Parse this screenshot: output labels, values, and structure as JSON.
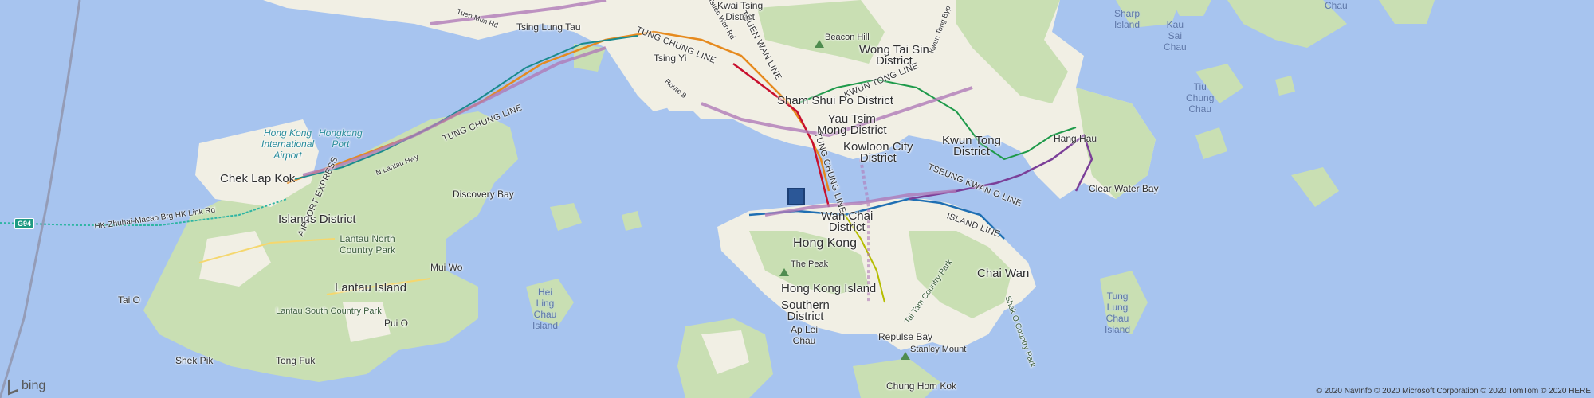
{
  "map": {
    "provider": "bing",
    "copyright": "© 2020 NavInfo © 2020 Microsoft Corporation © 2020 TomTom © 2020 HERE",
    "marker_icon": "location-square-marker",
    "colors": {
      "water": "#a7c4ef",
      "land": "#f1efe4",
      "park": "#c9dfb3",
      "rail_purple": "#b07ab8",
      "rail_red": "#c8102e",
      "rail_orange": "#e68a1e",
      "rail_teal": "#1a8b8e"
    }
  },
  "labels": {
    "kwai_tsing_1": "Kwai Tsing",
    "kwai_tsing_2": "District",
    "beacon_hill": "Beacon Hill",
    "wong_tai_sin_1": "Wong Tai Sin",
    "wong_tai_sin_2": "District",
    "sharp_island_1": "Sharp",
    "sharp_island_2": "Island",
    "kau_sai_chau_1": "Kau",
    "kau_sai_chau_2": "Sai",
    "kau_sai_chau_3": "Chau",
    "chau_top": "Chau",
    "tsing_lung_tau": "Tsing Lung Tau",
    "tsing_yi": "Tsing Yi",
    "sham_shui_po": "Sham Shui Po District",
    "tiu_chung_chau_1": "Tiu",
    "tiu_chung_chau_2": "Chung",
    "tiu_chung_chau_3": "Chau",
    "yau_tsim_mong_1": "Yau Tsim",
    "yau_tsim_mong_2": "Mong District",
    "kwun_tong_1": "Kwun Tong",
    "kwun_tong_2": "District",
    "hang_hau": "Hang Hau",
    "kowloon_city_1": "Kowloon City",
    "kowloon_city_2": "District",
    "hk_airport_1": "Hong Kong",
    "hk_airport_2": "International",
    "hk_airport_3": "Airport",
    "hongkong_port_1": "Hongkong",
    "hongkong_port_2": "Port",
    "chek_lap_kok": "Chek Lap Kok",
    "clear_water_bay": "Clear Water Bay",
    "discovery_bay": "Discovery Bay",
    "islands_district": "Islands District",
    "wan_chai_1": "Wan Chai",
    "wan_chai_2": "District",
    "hong_kong": "Hong Kong",
    "lantau_north_1": "Lantau North",
    "lantau_north_2": "Country Park",
    "lantau_island": "Lantau Island",
    "mui_wo": "Mui Wo",
    "the_peak": "The Peak",
    "chai_wan": "Chai Wan",
    "hei_ling_chau_1": "Hei",
    "hei_ling_chau_2": "Ling",
    "hei_ling_chau_3": "Chau",
    "hei_ling_chau_4": "Island",
    "hong_kong_island": "Hong Kong Island",
    "tai_o": "Tai O",
    "southern_1": "Southern",
    "southern_2": "District",
    "ap_lei_chau_1": "Ap Lei",
    "ap_lei_chau_2": "Chau",
    "tung_lung_1": "Tung",
    "tung_lung_2": "Lung",
    "tung_lung_3": "Chau",
    "tung_lung_4": "Island",
    "lantau_south": "Lantau South Country Park",
    "pui_o": "Pui O",
    "repulse_bay": "Repulse Bay",
    "stanley_mount": "Stanley Mount",
    "shek_pik": "Shek Pik",
    "tong_fuk": "Tong Fuk",
    "chung_hom_kok": "Chung Hom Kok",
    "tai_tam_park": "Tai Tam Country Park",
    "shek_o_park": "Shek O Country Park",
    "tung_chung_line_1": "TUNG CHUNG LINE",
    "tung_chung_line_2": "TUNG CHUNG LINE",
    "tung_chung_line_3": "TUNG CHUNG LINE",
    "tsuen_wan_line": "TSUEN WAN LINE",
    "kwun_tong_line": "KWUN TONG LINE",
    "airport_express": "AIRPORT EXPRESS",
    "tseung_kwan_o_line": "TSEUNG KWAN O LINE",
    "island_line": "ISLAND LINE",
    "hzm_bridge": "HK-Zhuhai-Macao Brg HK Link Rd",
    "lantau_hwy": "N Lantau Hwy",
    "route_8": "Route 8",
    "tuen_mun_rd": "Tuen Mun Rd",
    "tsuen_wan_rd": "Tsuen Wan Rd",
    "kwun_tong_bypass": "Kwun Tong Byp",
    "shield_g94": "G94",
    "bing": "bing"
  }
}
